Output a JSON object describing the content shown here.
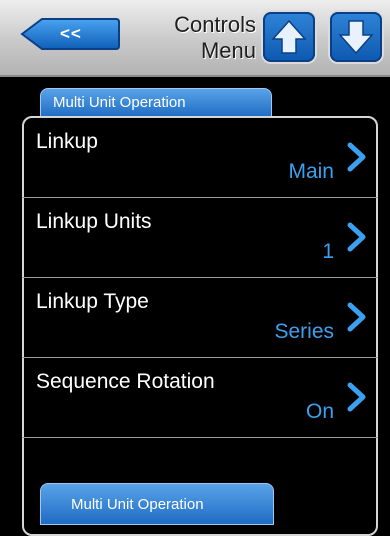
{
  "header": {
    "back_label": "<<",
    "title_line1": "Controls",
    "title_line2": "Menu"
  },
  "section_tab": {
    "label": "Multi Unit Operation"
  },
  "rows": [
    {
      "label": "Linkup",
      "value": "Main"
    },
    {
      "label": "Linkup Units",
      "value": "1"
    },
    {
      "label": "Linkup Type",
      "value": "Series"
    },
    {
      "label": "Sequence Rotation",
      "value": "On"
    }
  ],
  "bottom_tab": {
    "label": "Multi Unit Operation"
  },
  "colors": {
    "accent_blue": "#1e6cc4",
    "value_text": "#3ba1ee",
    "header_bg": "#c9c9c9"
  },
  "icons": [
    "back-arrow-icon",
    "up-arrow-icon",
    "down-arrow-icon",
    "chevron-right-icon"
  ]
}
